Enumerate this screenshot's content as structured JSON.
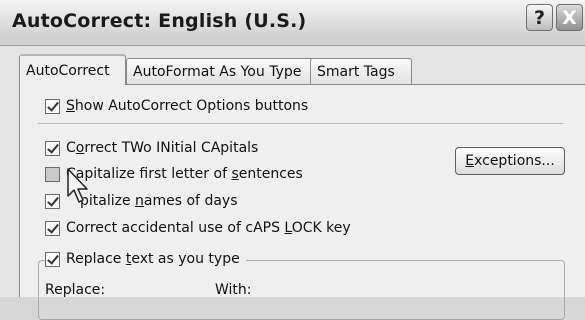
{
  "window": {
    "title": "AutoCorrect: English (U.S.)",
    "help_label": "?",
    "close_label": "X"
  },
  "tabs": [
    {
      "label": "AutoCorrect",
      "active": true
    },
    {
      "label": "AutoFormat As You Type",
      "active": false
    },
    {
      "label": "Smart Tags",
      "active": false
    }
  ],
  "options": {
    "show_buttons": {
      "before": "",
      "key": "S",
      "after": "how AutoCorrect Options buttons",
      "checked": true
    },
    "two_initial_caps": {
      "before": "C",
      "key": "o",
      "after": "rrect TWo INitial CApitals",
      "checked": true
    },
    "capitalize_sentences": {
      "before": "Capitalize first letter of ",
      "key": "s",
      "after": "entences",
      "checked": false
    },
    "capitalize_days": {
      "before": "",
      "key": "",
      "after": "pitalize ",
      "key2": "n",
      "after2": "ames of days",
      "checked": true
    },
    "caps_lock": {
      "before": "Correct accidental use of cAPS ",
      "key": "L",
      "after": "OCK key",
      "checked": true
    },
    "replace_text": {
      "before": "Replace ",
      "key": "t",
      "after": "ext as you type",
      "checked": true
    }
  },
  "buttons": {
    "exceptions": {
      "before": "",
      "key": "E",
      "after": "xceptions..."
    }
  },
  "fields": {
    "replace_label": "Replace:",
    "with_label": "With:"
  },
  "colors": {
    "background": "#e4e4e4",
    "panel": "#efefef"
  }
}
